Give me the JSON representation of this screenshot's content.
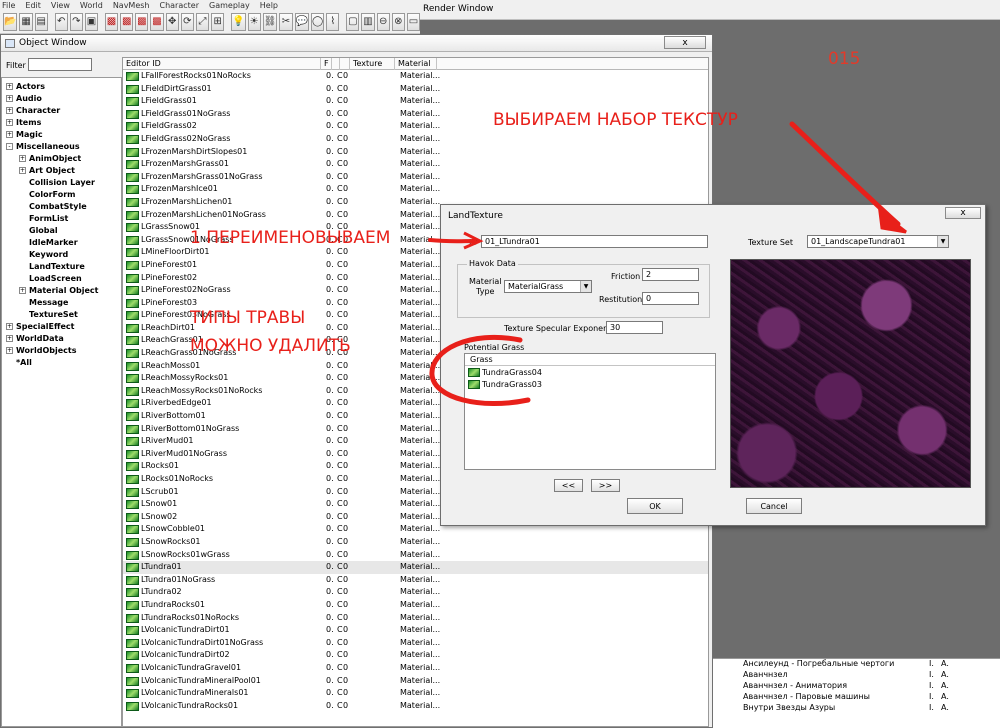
{
  "menu": {
    "items": [
      "File",
      "Edit",
      "View",
      "World",
      "NavMesh",
      "Character",
      "Gameplay",
      "Help"
    ]
  },
  "render_window": {
    "title": "Render Window"
  },
  "watermark": "015",
  "object_window": {
    "title": "Object Window",
    "close_label": "x",
    "filter_label": "Filter",
    "filter_value": "",
    "columns": {
      "editor_id": "Editor ID",
      "f": "F",
      "texture": "Texture",
      "material": "Material"
    },
    "tree": [
      {
        "label": "Actors",
        "expand": "+"
      },
      {
        "label": "Audio",
        "expand": "+"
      },
      {
        "label": "Character",
        "expand": "+"
      },
      {
        "label": "Items",
        "expand": "+"
      },
      {
        "label": "Magic",
        "expand": "+"
      },
      {
        "label": "Miscellaneous",
        "expand": "-"
      },
      {
        "label": "AnimObject",
        "expand": "+",
        "indent": 1
      },
      {
        "label": "Art Object",
        "expand": "+",
        "indent": 1
      },
      {
        "label": "Collision Layer",
        "expand": "",
        "indent": 1
      },
      {
        "label": "ColorForm",
        "expand": "",
        "indent": 1
      },
      {
        "label": "CombatStyle",
        "expand": "",
        "indent": 1
      },
      {
        "label": "FormList",
        "expand": "",
        "indent": 1
      },
      {
        "label": "Global",
        "expand": "",
        "indent": 1
      },
      {
        "label": "IdleMarker",
        "expand": "",
        "indent": 1
      },
      {
        "label": "Keyword",
        "expand": "",
        "indent": 1
      },
      {
        "label": "LandTexture",
        "expand": "",
        "indent": 1
      },
      {
        "label": "LoadScreen",
        "expand": "",
        "indent": 1
      },
      {
        "label": "Material Object",
        "expand": "+",
        "indent": 1
      },
      {
        "label": "Message",
        "expand": "",
        "indent": 1
      },
      {
        "label": "TextureSet",
        "expand": "",
        "indent": 1
      },
      {
        "label": "SpecialEffect",
        "expand": "+"
      },
      {
        "label": "WorldData",
        "expand": "+"
      },
      {
        "label": "WorldObjects",
        "expand": "+"
      },
      {
        "label": "*All",
        "expand": ""
      }
    ],
    "rows": [
      "LFallForestRocks01NoRocks",
      "LFieldDirtGrass01",
      "LFieldGrass01",
      "LFieldGrass01NoGrass",
      "LFieldGrass02",
      "LFieldGrass02NoGrass",
      "LFrozenMarshDirtSlopes01",
      "LFrozenMarshGrass01",
      "LFrozenMarshGrass01NoGrass",
      "LFrozenMarshIce01",
      "LFrozenMarshLichen01",
      "LFrozenMarshLichen01NoGrass",
      "LGrassSnow01",
      "LGrassSnow01NoGrass",
      "LMineFloorDirt01",
      "LPineForest01",
      "LPineForest02",
      "LPineForest02NoGrass",
      "LPineForest03",
      "LPineForest03NoGrass",
      "LReachDirt01",
      "LReachGrass01",
      "LReachGrass01NoGrass",
      "LReachMoss01",
      "LReachMossyRocks01",
      "LReachMossyRocks01NoRocks",
      "LRiverbedEdge01",
      "LRiverBottom01",
      "LRiverBottom01NoGrass",
      "LRiverMud01",
      "LRiverMud01NoGrass",
      "LRocks01",
      "LRocks01NoRocks",
      "LScrub01",
      "LSnow01",
      "LSnow02",
      "LSnowCobble01",
      "LSnowRocks01",
      "LSnowRocks01wGrass",
      "LTundra01",
      "LTundra01NoGrass",
      "LTundra02",
      "LTundraRocks01",
      "LTundraRocks01NoRocks",
      "LVolcanicTundraDirt01",
      "LVolcanicTundraDirt01NoGrass",
      "LVolcanicTundraDirt02",
      "LVolcanicTundraGravel01",
      "LVolcanicTundraMineralPool01",
      "LVolcanicTundraMinerals01",
      "LVolcanicTundraRocks01"
    ],
    "row_f": "0.",
    "row_c": "C",
    "row_d": "0",
    "row_material": "Material..."
  },
  "dialog": {
    "title": "LandTexture",
    "close_label": "x",
    "id_label": "ID",
    "id_value": "01_LTundra01",
    "texture_set_label": "Texture Set",
    "texture_set_value": "01_LandscapeTundra01",
    "havok_title": "Havok Data",
    "material_type_label": "Material\nType",
    "material_type_value": "MaterialGrass",
    "friction_label": "Friction",
    "friction_value": "2",
    "restitution_label": "Restitution",
    "restitution_value": "0",
    "specular_label": "Texture Specular Exponent",
    "specular_value": "30",
    "potential_grass_label": "Potential Grass",
    "grass_header": "Grass",
    "grass": [
      "TundraGrass04",
      "TundraGrass03"
    ],
    "prev_label": "<<",
    "next_label": ">>",
    "ok_label": "OK",
    "cancel_label": "Cancel"
  },
  "bottom_list": [
    {
      "name": "Ансилеунд - Погребальные чертоги",
      "c1": "I.",
      "c2": "A."
    },
    {
      "name": "Аванчнзел",
      "c1": "I.",
      "c2": "A."
    },
    {
      "name": "Аванчнзел - Аниматория",
      "c1": "I.",
      "c2": "A."
    },
    {
      "name": "Аванчнзел - Паровые машины",
      "c1": "I.",
      "c2": "A."
    },
    {
      "name": "Внутри Звезды Азуры",
      "c1": "I.",
      "c2": "A."
    }
  ],
  "annotations": {
    "texture_set": "ВЫБИРАЕМ НАБОР ТЕКСТУР",
    "rename": "1 ПЕРЕИМЕНОВЫВАЕМ",
    "grass_line1": "ТИПЫ ТРАВЫ",
    "grass_line2": "МОЖНО УДАЛИТЬ",
    "color": "#e8201a"
  }
}
